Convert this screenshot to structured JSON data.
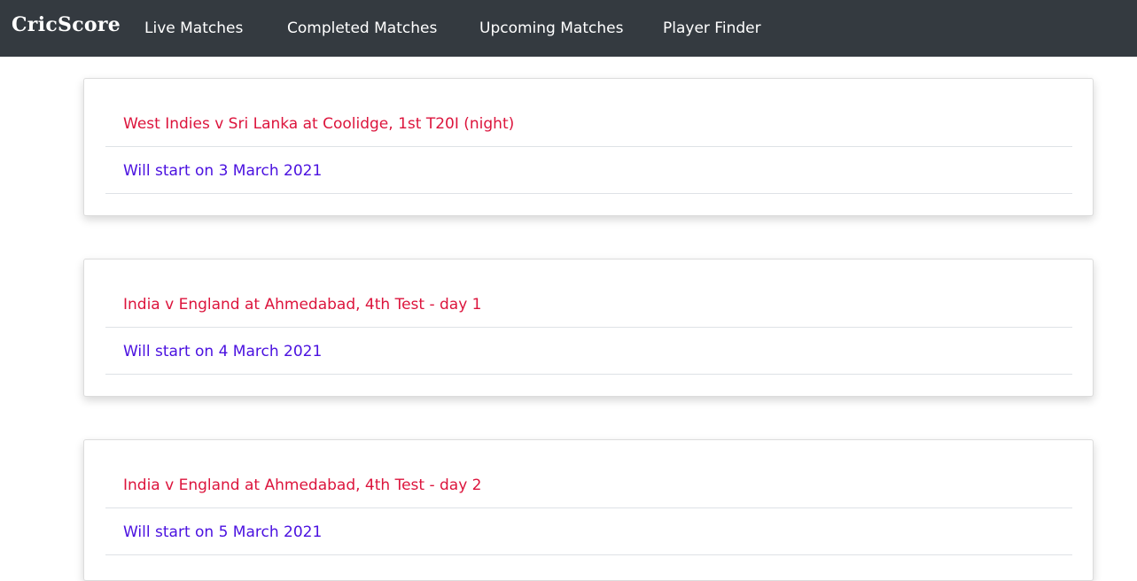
{
  "navbar": {
    "brand": "CricScore",
    "links": [
      {
        "label": "Live Matches"
      },
      {
        "label": "Completed Matches"
      },
      {
        "label": "Upcoming Matches"
      },
      {
        "label": "Player Finder"
      }
    ]
  },
  "matches": [
    {
      "title": "West Indies v Sri Lanka at Coolidge, 1st T20I (night)",
      "status": "Will start on 3 March 2021"
    },
    {
      "title": "India v England at Ahmedabad, 4th Test - day 1",
      "status": "Will start on 4 March 2021"
    },
    {
      "title": "India v England at Ahmedabad, 4th Test - day 2",
      "status": "Will start on 5 March 2021"
    }
  ],
  "colors": {
    "navbar_bg": "#343a40",
    "title_color": "#dc143c",
    "status_color": "#4b12e0"
  }
}
